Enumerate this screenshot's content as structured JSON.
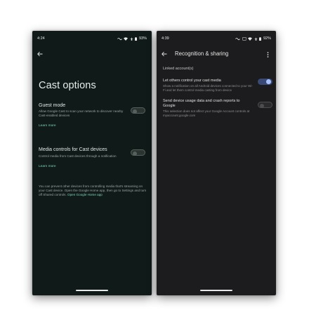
{
  "left_phone": {
    "status": {
      "time": "4:24",
      "battery": "93%"
    },
    "title": "Cast options",
    "guest_mode": {
      "title": "Guest mode",
      "subtitle": "Allow Google Cast to scan your network to discover nearby Cast-enabled devices",
      "learn_more": "Learn more",
      "enabled": false
    },
    "media_controls": {
      "title": "Media controls for Cast devices",
      "subtitle": "Control media from Cast devices through a notification",
      "learn_more": "Learn more",
      "enabled": false
    },
    "footer": {
      "text": "You can prevent other devices from controlling media that's streaming on your Cast device. Open the Google Home app, then go to Settings and turn off Shared controls.",
      "link": "Open Google Home app"
    }
  },
  "right_phone": {
    "status": {
      "time": "4:39",
      "battery": "92%"
    },
    "title": "Recognition & sharing",
    "section": "Linked account(s)",
    "let_others": {
      "title": "Let others control your cast media",
      "subtitle": "Show a notification on all Android devices connected to your Wi-Fi and let them control media casting from device",
      "enabled": true
    },
    "usage_data": {
      "title": "Send device usage data and crash reports to Google",
      "subtitle": "This selection does not affect your Google Account controls at myaccount.google.com",
      "enabled": false
    }
  },
  "colors": {
    "left_bg": "#101a18",
    "right_bg": "#1c1c1e",
    "link": "#7fd4bd",
    "toggle_on": "#a8c4ff"
  },
  "icons": [
    "back-arrow-icon",
    "more-vert-icon",
    "wifi-icon",
    "signal-icon",
    "battery-icon",
    "mute-icon",
    "cast-icon"
  ]
}
